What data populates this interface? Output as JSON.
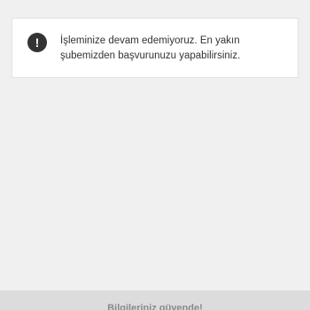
{
  "alert": {
    "icon": "exclamation-icon",
    "icon_glyph": "!",
    "message": "İşleminize devam edemiyoruz. En yakın şubemizden başvurunuzu yapabilirsiniz."
  },
  "footer": {
    "security_text": "Bilgileriniz güvende!"
  }
}
